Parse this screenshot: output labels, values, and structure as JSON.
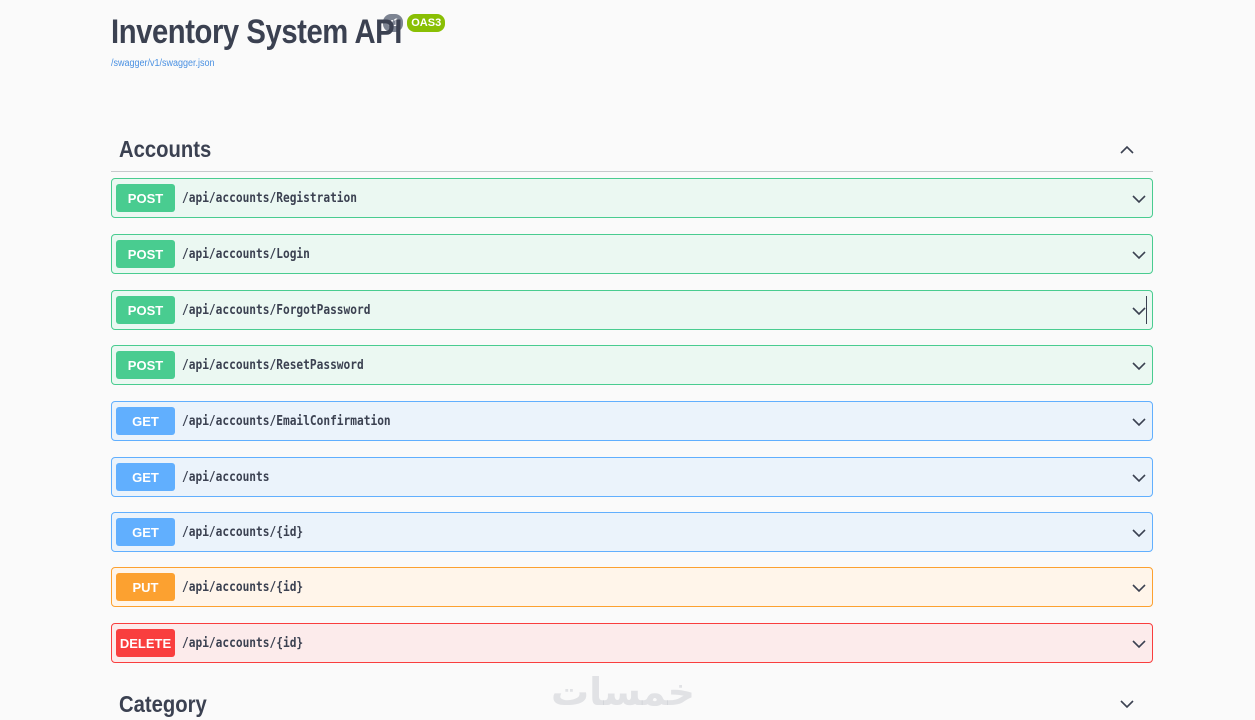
{
  "info": {
    "title": "Inventory System API",
    "version_badge": "v1",
    "oas_badge": "OAS3",
    "spec_link": "/swagger/v1/swagger.json"
  },
  "tags": [
    {
      "name": "Accounts",
      "expanded": true,
      "arrow_icon": "chevron-up-icon"
    },
    {
      "name": "Category",
      "expanded": false,
      "arrow_icon": "chevron-down-icon"
    }
  ],
  "operations": [
    {
      "method": "POST",
      "path": "/api/accounts/Registration"
    },
    {
      "method": "POST",
      "path": "/api/accounts/Login"
    },
    {
      "method": "POST",
      "path": "/api/accounts/ForgotPassword"
    },
    {
      "method": "POST",
      "path": "/api/accounts/ResetPassword"
    },
    {
      "method": "GET",
      "path": "/api/accounts/EmailConfirmation"
    },
    {
      "method": "GET",
      "path": "/api/accounts"
    },
    {
      "method": "GET",
      "path": "/api/accounts/{id}"
    },
    {
      "method": "PUT",
      "path": "/api/accounts/{id}"
    },
    {
      "method": "DELETE",
      "path": "/api/accounts/{id}"
    }
  ],
  "colors": {
    "post": "#49cc90",
    "get": "#61affe",
    "put": "#fca130",
    "delete": "#f93e3e",
    "link": "#4990e2"
  },
  "watermark": "خمسات"
}
